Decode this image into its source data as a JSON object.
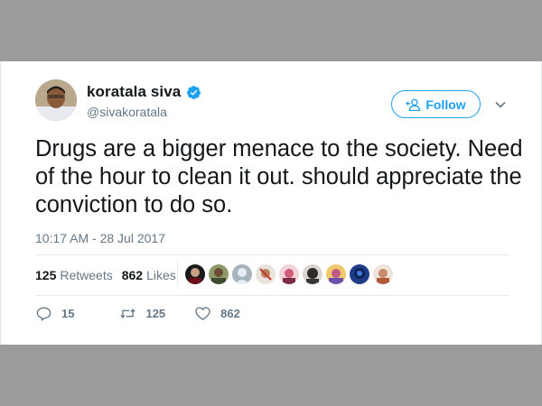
{
  "user": {
    "display_name": "koratala siva",
    "handle": "@sivakoratala",
    "verified": true
  },
  "follow_button": {
    "label": "Follow"
  },
  "tweet": {
    "text": "Drugs are a bigger menace to the society. Need of the hour to clean it out. should appreciate the conviction to do so.",
    "timestamp": "10:17 AM - 28 Jul 2017"
  },
  "stats": {
    "retweets_count": "125",
    "retweets_label": "Retweets",
    "likes_count": "862",
    "likes_label": "Likes"
  },
  "actions": {
    "reply_count": "15",
    "retweet_count": "125",
    "like_count": "862"
  },
  "colors": {
    "accent": "#1da1f2",
    "secondary_text": "#657786",
    "primary_text": "#14171a",
    "background": "#9b9b9b"
  },
  "icons": [
    "verified-badge-icon",
    "add-user-icon",
    "chevron-down-icon",
    "reply-icon",
    "retweet-icon",
    "like-icon"
  ]
}
